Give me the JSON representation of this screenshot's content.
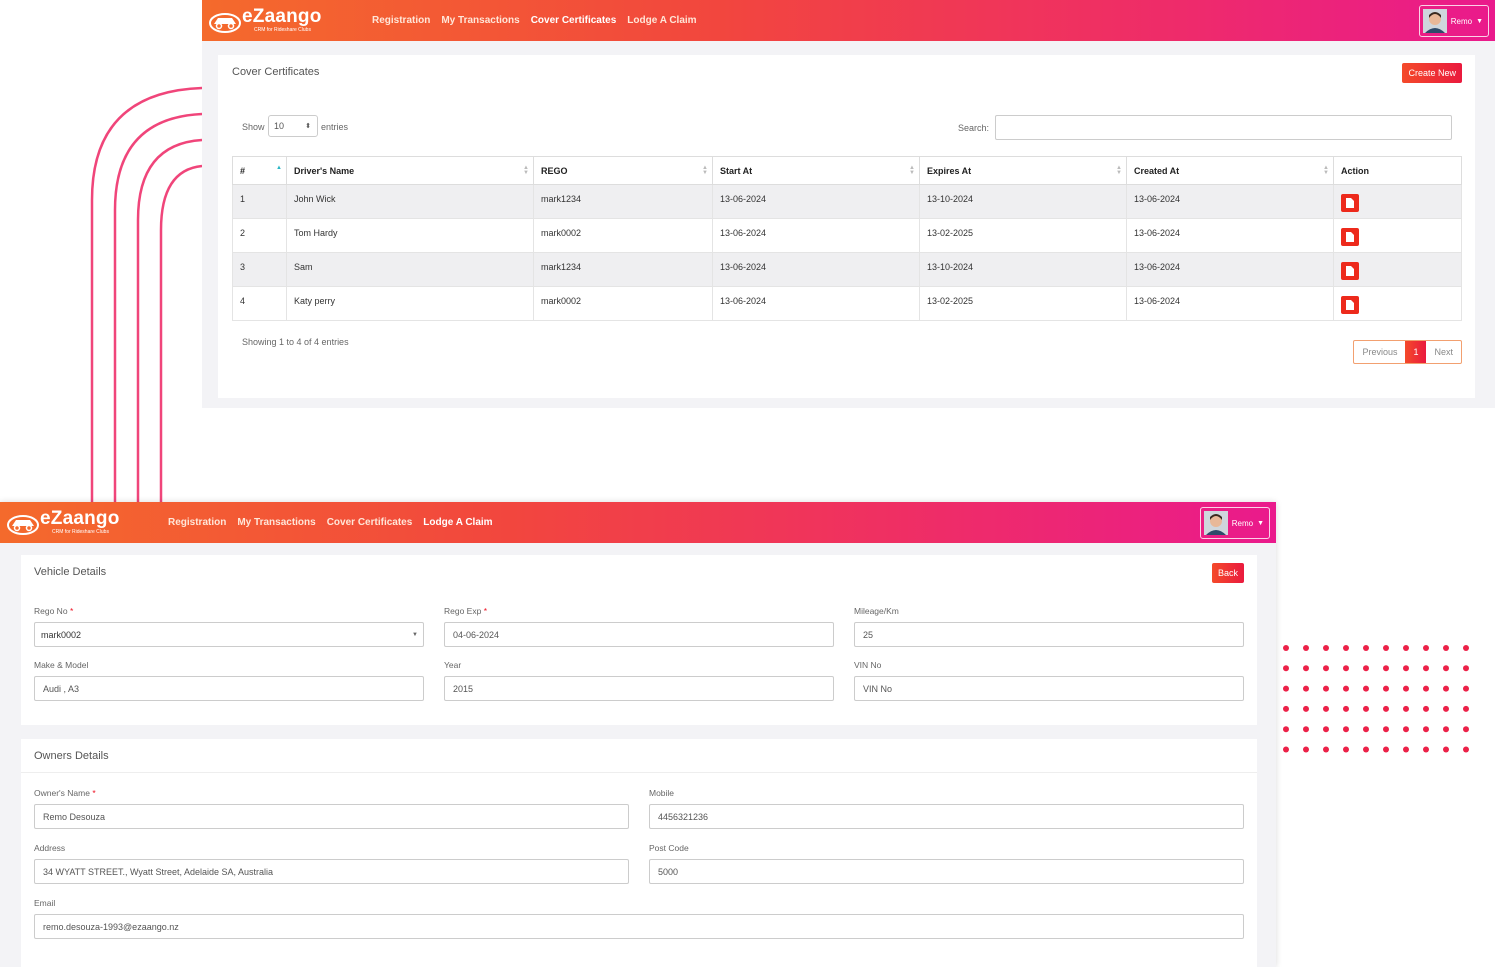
{
  "colors": {
    "accent": "#f2271d",
    "gradient_start": "#f46a2c",
    "gradient_end": "#ea1a8c"
  },
  "screen1": {
    "header": {
      "brand": "eZaango",
      "brand_sub": "CRM for Rideshare Clubs",
      "nav": [
        "Registration",
        "My Transactions",
        "Cover Certificates",
        "Lodge A Claim"
      ],
      "active_nav": "Cover Certificates",
      "user": "Remo"
    },
    "page_title": "Cover Certificates",
    "create_button": "Create New",
    "show_label": "Show",
    "entries_value": "10",
    "entries_label": "entries",
    "search_label": "Search:",
    "search_value": "",
    "columns": [
      "#",
      "Driver's Name",
      "REGO",
      "Start At",
      "Expires At",
      "Created At",
      "Action"
    ],
    "rows": [
      {
        "num": "1",
        "driver": "John Wick",
        "rego": "mark1234",
        "start": "13-06-2024",
        "expires": "13-10-2024",
        "created": "13-06-2024"
      },
      {
        "num": "2",
        "driver": "Tom Hardy",
        "rego": "mark0002",
        "start": "13-06-2024",
        "expires": "13-02-2025",
        "created": "13-06-2024"
      },
      {
        "num": "3",
        "driver": "Sam",
        "rego": "mark1234",
        "start": "13-06-2024",
        "expires": "13-10-2024",
        "created": "13-06-2024"
      },
      {
        "num": "4",
        "driver": "Katy perry",
        "rego": "mark0002",
        "start": "13-06-2024",
        "expires": "13-02-2025",
        "created": "13-06-2024"
      }
    ],
    "showing": "Showing 1 to 4 of 4 entries",
    "pager": {
      "prev": "Previous",
      "current": "1",
      "next": "Next"
    }
  },
  "screen2": {
    "header": {
      "brand": "eZaango",
      "brand_sub": "CRM for Rideshare Clubs",
      "nav": [
        "Registration",
        "My Transactions",
        "Cover Certificates",
        "Lodge A Claim"
      ],
      "active_nav": "Lodge A Claim",
      "user": "Remo"
    },
    "vehicle": {
      "title": "Vehicle Details",
      "back_button": "Back",
      "rego_no_label": "Rego No",
      "rego_no_value": "mark0002",
      "rego_exp_label": "Rego Exp",
      "rego_exp_value": "04-06-2024",
      "mileage_label": "Mileage/Km",
      "mileage_value": "25",
      "make_label": "Make & Model",
      "make_value": "Audi , A3",
      "year_label": "Year",
      "year_value": "2015",
      "vin_label": "VIN No",
      "vin_value": "VIN No"
    },
    "owner": {
      "title": "Owners Details",
      "name_label": "Owner's Name",
      "name_value": "Remo Desouza",
      "mobile_label": "Mobile",
      "mobile_value": "4456321236",
      "address_label": "Address",
      "address_value": "34 WYATT STREET., Wyatt Street, Adelaide SA, Australia",
      "postcode_label": "Post Code",
      "postcode_value": "5000",
      "email_label": "Email",
      "email_value": "remo.desouza-1993@ezaango.nz"
    }
  }
}
